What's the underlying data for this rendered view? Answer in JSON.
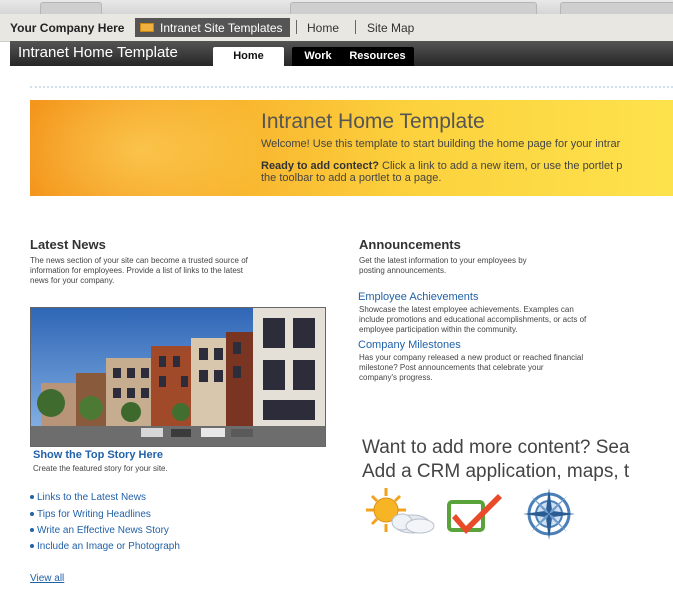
{
  "top_bar": {
    "company": "Your Company Here",
    "site_tab_label": "Intranet Site Templates",
    "home_link": "Home",
    "site_map_link": "Site Map"
  },
  "nav": {
    "title": "Intranet Home Template",
    "tabs": [
      "Home",
      "Work",
      "Resources"
    ]
  },
  "banner": {
    "title": "Intranet Home Template",
    "welcome": "Welcome! Use this template to start building the home page for your intrar",
    "ready_bold": "Ready to add contect?",
    "ready_rest": " Click a link to add a new item, or use the portlet p",
    "ready_line2": "the toolbar to add a portlet to a page."
  },
  "latest_news": {
    "heading": "Latest News",
    "desc_lines": [
      "The news section of your site can become a trusted source of",
      "information for employees. Provide a list of links to the latest",
      "news for your company."
    ],
    "top_story": "Show the Top Story Here",
    "top_story_desc": "Create the featured story for your site.",
    "links": [
      "Links to the Latest News",
      "Tips for Writing Headlines",
      "Write an Effective News Story",
      "Include an Image or Photograph"
    ],
    "view_all": "View all"
  },
  "announcements": {
    "heading": "Announcements",
    "desc_lines": [
      "Get the latest information to your employees by",
      "posting announcements."
    ],
    "items": [
      {
        "title": "Employee Achievements",
        "lines": [
          "Showcase the latest employee achievements. Examples can",
          "include promotions and educational accomplishments, or acts of",
          "employee participation within the community."
        ]
      },
      {
        "title": "Company Milestones",
        "lines": [
          "Has your company released a new product or reached financial",
          "milestone? Post announcements that celebrate your",
          "company's progress."
        ]
      }
    ]
  },
  "promo": {
    "line1": "Want to add more content? Sea",
    "line2": "Add a CRM application, maps, t"
  },
  "icons": [
    "weather-icon",
    "checkmark-icon",
    "compass-icon"
  ],
  "colors": {
    "link": "#2262a8",
    "nav_bar": "#333333",
    "banner_orange": "#f4951c",
    "banner_yellow": "#fde24c"
  }
}
